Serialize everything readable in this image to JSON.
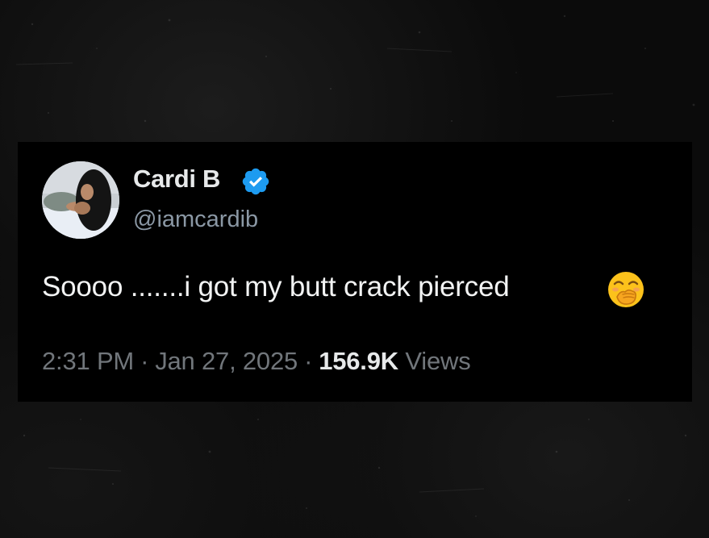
{
  "tweet": {
    "display_name": "Cardi B",
    "handle": "@iamcardib",
    "verified": true,
    "text": "Soooo .......i got my butt crack pierced",
    "emoji_icon": "face-with-hand-over-mouth-icon",
    "time": "2:31 PM",
    "separator": "·",
    "date": "Jan 27, 2025",
    "views_count": "156.9K",
    "views_label": "Views"
  },
  "colors": {
    "background": "#0a0a0a",
    "card": "#000000",
    "name": "#e7e9ea",
    "handle": "#8b98a5",
    "meta": "#71767b",
    "verified_badge": "#1d9bf0"
  }
}
